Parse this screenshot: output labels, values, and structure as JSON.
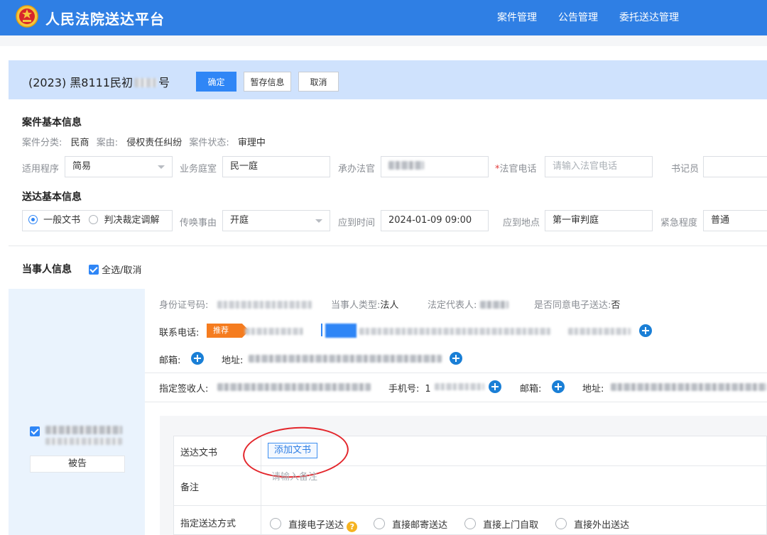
{
  "header": {
    "brand": "人民法院送达平台",
    "nav": [
      "案件管理",
      "公告管理",
      "委托送达管理"
    ]
  },
  "case_bar": {
    "case_no_prefix": "(2023) 黑8111民初",
    "case_no_suffix": "号",
    "confirm": "确定",
    "save_draft": "暂存信息",
    "cancel": "取消"
  },
  "case_info": {
    "title": "案件基本信息",
    "category_label": "案件分类:",
    "category": "民商",
    "cause_label": "案由:",
    "cause": "侵权责任纠纷",
    "status_label": "案件状态:",
    "status": "审理中",
    "procedure_label": "适用程序",
    "procedure": "简易",
    "court_label": "业务庭室",
    "court": "民一庭",
    "judge_label": "承办法官",
    "phone_label": "法官电话",
    "phone_required": "*",
    "phone_placeholder": "请输入法官电话",
    "clerk_label": "书记员"
  },
  "service_info": {
    "title": "送达基本信息",
    "type_options": [
      "一般文书",
      "判决裁定调解"
    ],
    "reason_label": "传唤事由",
    "reason": "开庭",
    "time_label": "应到时间",
    "time": "2024-01-09 09:00",
    "place_label": "应到地点",
    "place": "第一审判庭",
    "urgency_label": "紧急程度",
    "urgency": "普通"
  },
  "party_info": {
    "title": "当事人信息",
    "select_all": "全选/取消",
    "party_role": "被告",
    "id_label": "身份证号码:",
    "type_label": "当事人类型:",
    "type": "法人",
    "rep_label": "法定代表人:",
    "econsent_label": "是否同意电子送达:",
    "econsent": "否",
    "contact_label": "联系电话:",
    "recommend": "推荐",
    "email_label": "邮箱:",
    "address_label": "地址:",
    "signer_label": "指定签收人:",
    "mobile_label": "手机号:",
    "mobile_prefix": "1",
    "email2_label": "邮箱:",
    "address2_label": "地址:"
  },
  "document": {
    "doc_label": "送达文书",
    "add_doc": "添加文书",
    "remark_label": "备注",
    "remark_placeholder": "请输入备注",
    "method_label": "指定送达方式",
    "methods": [
      "直接电子送达",
      "直接邮寄送达",
      "直接上门自取",
      "直接外出送达"
    ]
  },
  "colors": {
    "primary": "#2f7fe4",
    "case_bar_bg": "#cfe2fd",
    "recommend_tag": "#f57c1f",
    "highlight_circle": "#e3262c"
  }
}
